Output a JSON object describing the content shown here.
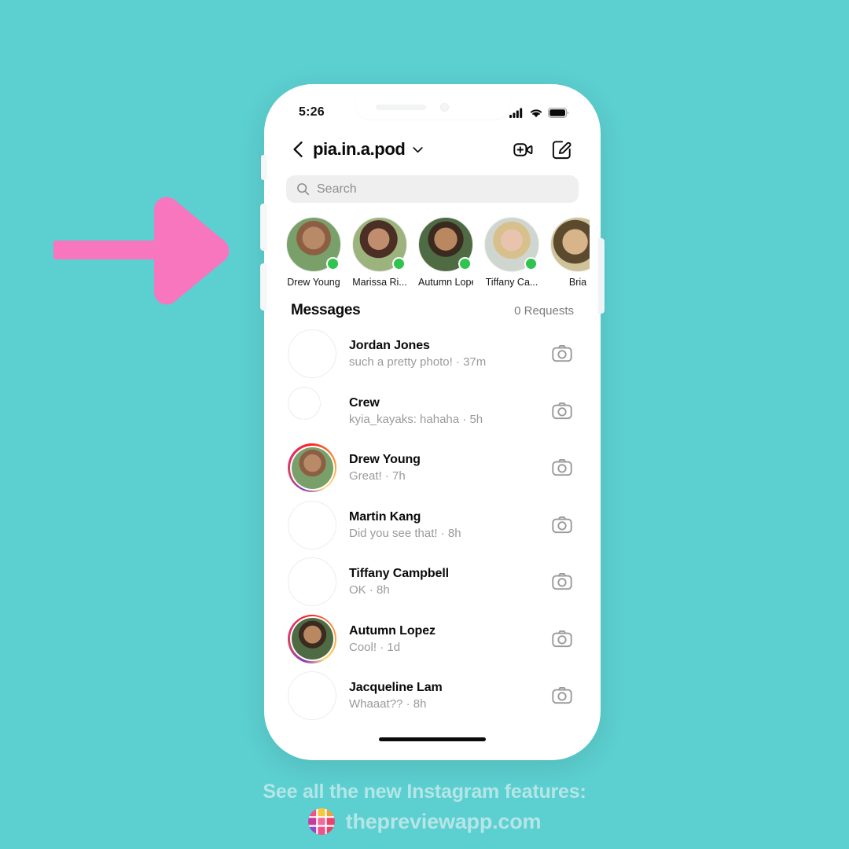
{
  "background_color": "#5ccfd0",
  "arrow": {
    "color": "#f876bd",
    "name": "pointer-arrow"
  },
  "phone": {
    "status_bar": {
      "time": "5:26",
      "signal_icon": "cellular-signal-icon",
      "wifi_icon": "wifi-icon",
      "battery_icon": "battery-full-icon"
    },
    "header": {
      "back_icon": "chevron-left-icon",
      "account_name": "pia.in.a.pod",
      "chevron_icon": "chevron-down-icon",
      "video_call_label": "new-video-call",
      "compose_label": "new-message"
    },
    "search": {
      "placeholder": "Search",
      "value": "",
      "icon": "search-icon"
    },
    "stories": [
      {
        "name": "Drew Young",
        "online": true,
        "photo": "p-drew"
      },
      {
        "name": "Marissa Ri...",
        "online": true,
        "photo": "p-marissa"
      },
      {
        "name": "Autumn Lopez",
        "online": true,
        "photo": "p-autumn"
      },
      {
        "name": "Tiffany Ca...",
        "online": true,
        "photo": "p-tiffany"
      },
      {
        "name": "Bria",
        "online": false,
        "photo": "p-brian"
      }
    ],
    "messages_header": {
      "title": "Messages",
      "requests": "0 Requests"
    },
    "conversations": [
      {
        "name": "Jordan Jones",
        "preview": "such a pretty photo!",
        "time": "37m",
        "ring": false,
        "group": false,
        "camera_icon": "camera-icon"
      },
      {
        "name": "Crew",
        "preview": "kyia_kayaks: hahaha",
        "time": "5h",
        "ring": false,
        "group": true,
        "camera_icon": "camera-icon"
      },
      {
        "name": "Drew Young",
        "preview": "Great!",
        "time": "7h",
        "ring": true,
        "group": false,
        "camera_icon": "camera-icon"
      },
      {
        "name": "Martin Kang",
        "preview": "Did you see that!",
        "time": "8h",
        "ring": false,
        "group": false,
        "camera_icon": "camera-icon"
      },
      {
        "name": "Tiffany Campbell",
        "preview": "OK",
        "time": "8h",
        "ring": false,
        "group": false,
        "camera_icon": "camera-icon"
      },
      {
        "name": "Autumn Lopez",
        "preview": "Cool!",
        "time": "1d",
        "ring": true,
        "group": false,
        "camera_icon": "camera-icon"
      },
      {
        "name": "Jacqueline Lam",
        "preview": "Whaaat??",
        "time": "8h",
        "ring": false,
        "group": false,
        "camera_icon": "camera-icon"
      }
    ]
  },
  "footer": {
    "line1": "See all the new Instagram features:",
    "line2": "thepreviewapp.com",
    "logo": "preview-app-logo",
    "text_color": "#b4e6e7"
  }
}
